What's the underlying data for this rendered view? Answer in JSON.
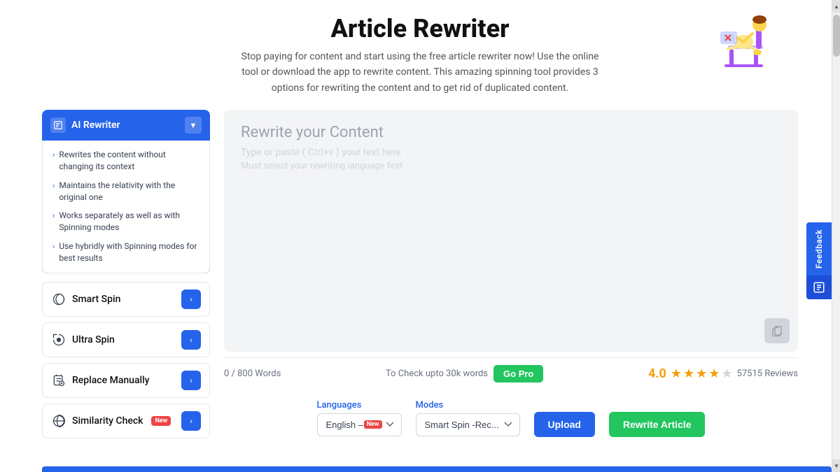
{
  "header": {
    "title": "Article Rewriter",
    "description": "Stop paying for content and start using the free article rewriter now! Use the online tool or download the app to rewrite content. This amazing spinning tool provides 3 options for rewriting the content and to get rid of duplicated content."
  },
  "sidebar": {
    "ai_rewriter": {
      "label": "AI Rewriter",
      "features": [
        "Rewrites the content without changing its context",
        "Maintains the relativity with the original one",
        "Works separately as well as with Spinning modes",
        "Use hybridly with Spinning modes for best results"
      ]
    },
    "items": [
      {
        "label": "Smart Spin",
        "icon": "⚙️"
      },
      {
        "label": "Ultra Spin",
        "icon": "🔄"
      },
      {
        "label": "Replace Manually",
        "icon": "📋"
      },
      {
        "label": "Similarity Check",
        "icon": "🌐",
        "badge": "New"
      }
    ]
  },
  "editor": {
    "placeholder_title": "Rewrite your Content",
    "placeholder_sub": "Type or paste ( Ctrl+v ) your text here",
    "placeholder_note": "Must select your rewriting language first",
    "word_count": "0 / 800 Words",
    "pro_text": "To Check upto 30k words",
    "go_pro_label": "Go Pro",
    "rating": "4.0",
    "reviews": "57515 Reviews"
  },
  "bottom_bar": {
    "languages_label": "Languages",
    "modes_label": "Modes",
    "language_value": "English – EN",
    "mode_value": "Smart Spin -Rec...",
    "upload_label": "Upload",
    "rewrite_label": "Rewrite Article"
  },
  "feedback": {
    "label": "Feedback"
  }
}
